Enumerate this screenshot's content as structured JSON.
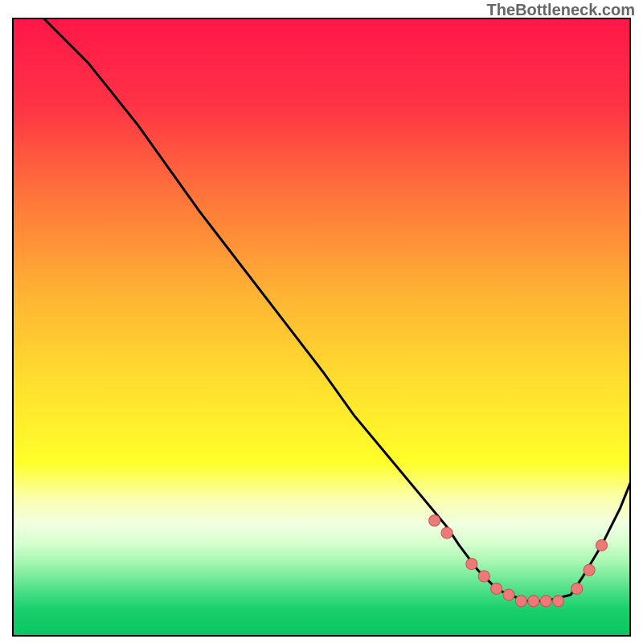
{
  "watermark": "TheBottleneck.com",
  "chart_data": {
    "type": "line",
    "title": "",
    "xlabel": "",
    "ylabel": "",
    "xlim": [
      0,
      100
    ],
    "ylim": [
      0,
      100
    ],
    "grid": false,
    "curve": {
      "name": "bottleneck-curve",
      "x": [
        0,
        5,
        12,
        20,
        30,
        40,
        50,
        55,
        60,
        65,
        70,
        72,
        75,
        78,
        80,
        83,
        86,
        90,
        92,
        95,
        98,
        100
      ],
      "y": [
        108,
        100,
        93,
        83,
        69,
        56,
        43,
        36,
        30,
        24,
        18,
        15,
        11,
        8,
        7,
        6,
        6,
        7,
        10,
        15,
        21,
        26
      ]
    },
    "markers": {
      "name": "highlight-points",
      "x": [
        68,
        70,
        74,
        76,
        78,
        80,
        82,
        84,
        86,
        88,
        91,
        93,
        95
      ],
      "y": [
        19,
        17,
        12,
        10,
        8,
        7,
        6,
        6,
        6,
        6,
        8,
        11,
        15
      ]
    },
    "gradient_stops": [
      {
        "offset": 0,
        "color": "#ff1749"
      },
      {
        "offset": 14,
        "color": "#ff3345"
      },
      {
        "offset": 30,
        "color": "#ff7a3a"
      },
      {
        "offset": 46,
        "color": "#ffb833"
      },
      {
        "offset": 60,
        "color": "#ffe12e"
      },
      {
        "offset": 72,
        "color": "#ffff2a"
      },
      {
        "offset": 78,
        "color": "#fbffb0"
      },
      {
        "offset": 82,
        "color": "#f1ffe0"
      },
      {
        "offset": 85,
        "color": "#d7ffd0"
      },
      {
        "offset": 88,
        "color": "#a9f7b3"
      },
      {
        "offset": 91,
        "color": "#6fe896"
      },
      {
        "offset": 94,
        "color": "#36d97c"
      },
      {
        "offset": 96,
        "color": "#17cf6b"
      },
      {
        "offset": 100,
        "color": "#0cc663"
      }
    ],
    "marker_color": "#ec7a78",
    "marker_stroke": "#c95050",
    "curve_color": "#000000",
    "curve_width": 3
  }
}
